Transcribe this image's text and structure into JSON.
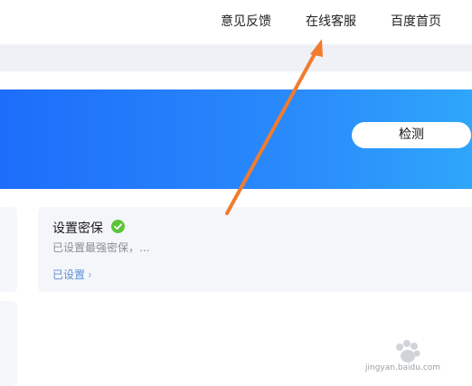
{
  "topnav": {
    "feedback": "意见反馈",
    "online_service": "在线客服",
    "baidu_home": "百度首页"
  },
  "banner": {
    "detect_button": "检测"
  },
  "card": {
    "title": "设置密保",
    "description": "已设置最强密保，...",
    "status": "已设置",
    "status_icon": "check-circle-icon",
    "chevron": "›"
  },
  "watermark": {
    "text": "jingyan.baidu.com"
  },
  "colors": {
    "banner_start": "#1d6dfa",
    "banner_end": "#2fa6fb",
    "check_green": "#5bc43a",
    "arrow_orange": "#f07c2e",
    "status_link": "#5b8fd6"
  }
}
